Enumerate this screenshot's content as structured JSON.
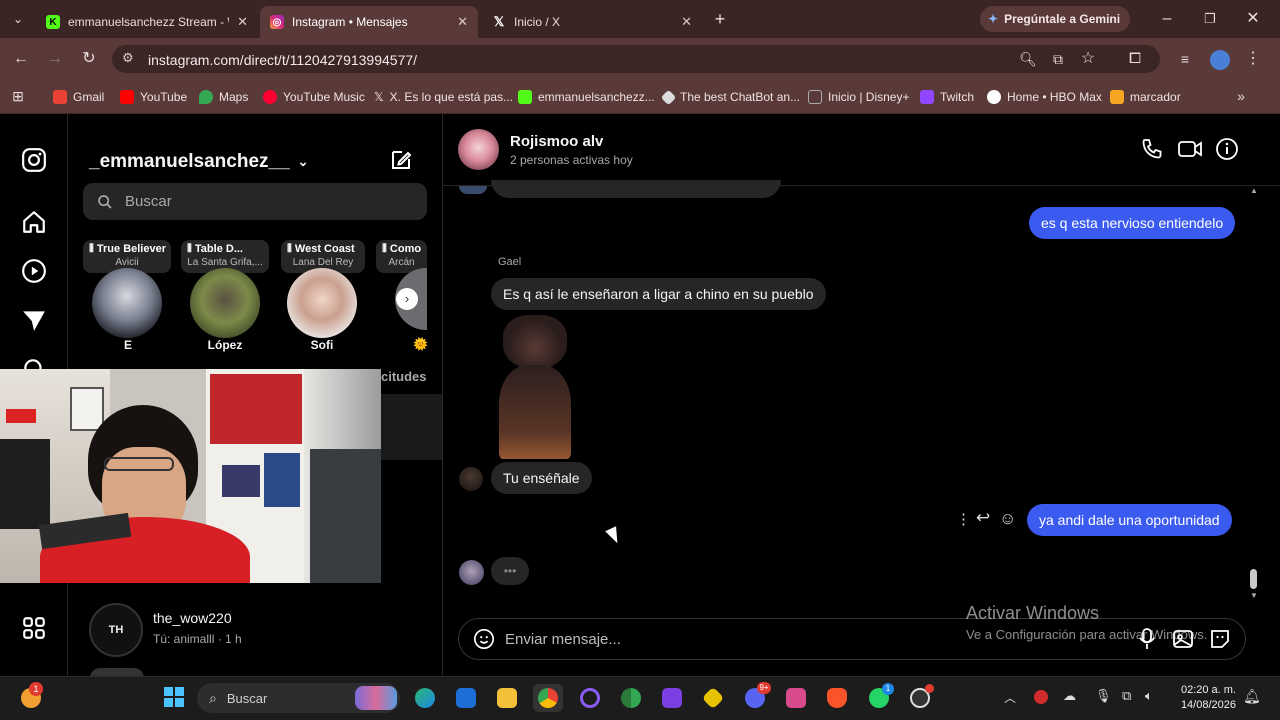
{
  "browser": {
    "tabs": [
      {
        "title": "emmanuelsanchezz Stream - W",
        "icon": "kick-icon"
      },
      {
        "title": "Instagram • Mensajes",
        "icon": "instagram-icon"
      },
      {
        "title": "Inicio / X",
        "icon": "x-icon"
      }
    ],
    "gemini_label": "Pregúntale a Gemini",
    "url": "instagram.com/direct/t/1120427913994577/",
    "bookmarks": [
      "Gmail",
      "YouTube",
      "Maps",
      "YouTube Music",
      "X. Es lo que está pas...",
      "emmanuelsanchezz...",
      "The best ChatBot an...",
      "Inicio | Disney+",
      "Twitch",
      "Home • HBO Max",
      "marcador"
    ]
  },
  "inbox": {
    "username": "_emmanuelsanchez__",
    "search_placeholder": "Buscar",
    "notes": [
      {
        "song": "True Believer",
        "artist": "Avicii"
      },
      {
        "song": "Table D...",
        "artist": "La Santa Grifa,..."
      },
      {
        "song": "West Coast",
        "artist": "Lana Del Rey"
      },
      {
        "song": "Como",
        "artist": "Arcán"
      }
    ],
    "stories": [
      {
        "name": "E"
      },
      {
        "name": "López"
      },
      {
        "name": "Sofi"
      },
      {
        "name": "🌞"
      }
    ],
    "requests_fragment": "citudes",
    "conversations": [
      {
        "name": "the_wow220",
        "preview": "Tú: animalll · 1 h"
      }
    ]
  },
  "chat": {
    "contact_name": "Rojismoo alv",
    "status": "2 personas activas hoy",
    "messages": [
      {
        "from": "me",
        "text": "es q esta nervioso entiendelo"
      },
      {
        "from": "Gael",
        "sender_label": "Gael",
        "text": "Es q así le enseñaron a ligar a chino en su pueblo"
      },
      {
        "from": "other",
        "text": "Tu enséñale"
      },
      {
        "from": "me",
        "text": "ya andi dale una oportunidad"
      }
    ],
    "typing": "•••",
    "composer_placeholder": "Enviar mensaje..."
  },
  "watermark": {
    "title": "Activar Windows",
    "subtitle": "Ve a Configuración para activar Windows."
  },
  "taskbar": {
    "search_placeholder": "Buscar",
    "time": "02:20 a. m.",
    "date": "14/08/2026",
    "notification_badge": "1",
    "discord_badge": "9+",
    "whatsapp_badge": "1"
  },
  "colors": {
    "accent_blue": "#3b5bf0",
    "chrome_bg": "#5a3a38",
    "incoming_bubble": "#262626"
  }
}
